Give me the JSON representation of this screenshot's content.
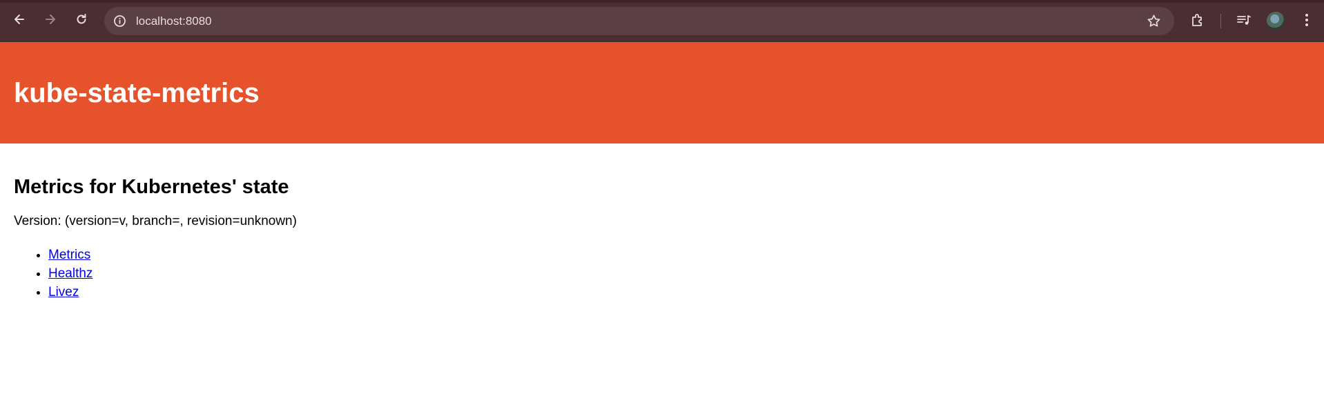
{
  "browser": {
    "url": "localhost:8080",
    "icons": {
      "back": "arrow-left-icon",
      "forward": "arrow-right-icon",
      "reload": "reload-icon",
      "info": "info-icon",
      "bookmark": "star-icon",
      "extensions": "puzzle-icon",
      "media": "playlist-icon",
      "menu": "kebab-menu-icon"
    },
    "colors": {
      "frame": "#4a2e33",
      "omnibox": "#5a3f45"
    }
  },
  "header": {
    "title": "kube-state-metrics",
    "background": "#e6522c"
  },
  "main": {
    "heading": "Metrics for Kubernetes' state",
    "version": "Version: (version=v, branch=, revision=unknown)",
    "links": [
      {
        "label": "Metrics"
      },
      {
        "label": "Healthz"
      },
      {
        "label": "Livez"
      }
    ]
  }
}
